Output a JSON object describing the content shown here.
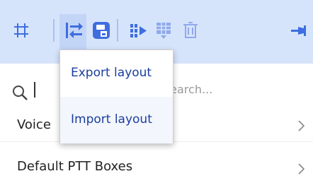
{
  "toolbar": {
    "icons": [
      "grid-icon",
      "export-import-icon",
      "save-layout-icon",
      "move-columns-icon",
      "split-view-icon",
      "delete-icon",
      "pin-icon"
    ],
    "icon_color": "#3f6de0",
    "pressed_button": "export-import-button"
  },
  "dropdown": {
    "items": [
      {
        "label": "Export layout"
      },
      {
        "label": "Import layout"
      }
    ]
  },
  "search": {
    "placeholder": "Search..."
  },
  "list": {
    "items": [
      {
        "label": "Voice"
      },
      {
        "label": "Default PTT Boxes"
      }
    ]
  },
  "colors": {
    "toolbar_bg": "#d6e4fb",
    "accent": "#3f6de0",
    "menu_text": "#1a3e9e"
  }
}
